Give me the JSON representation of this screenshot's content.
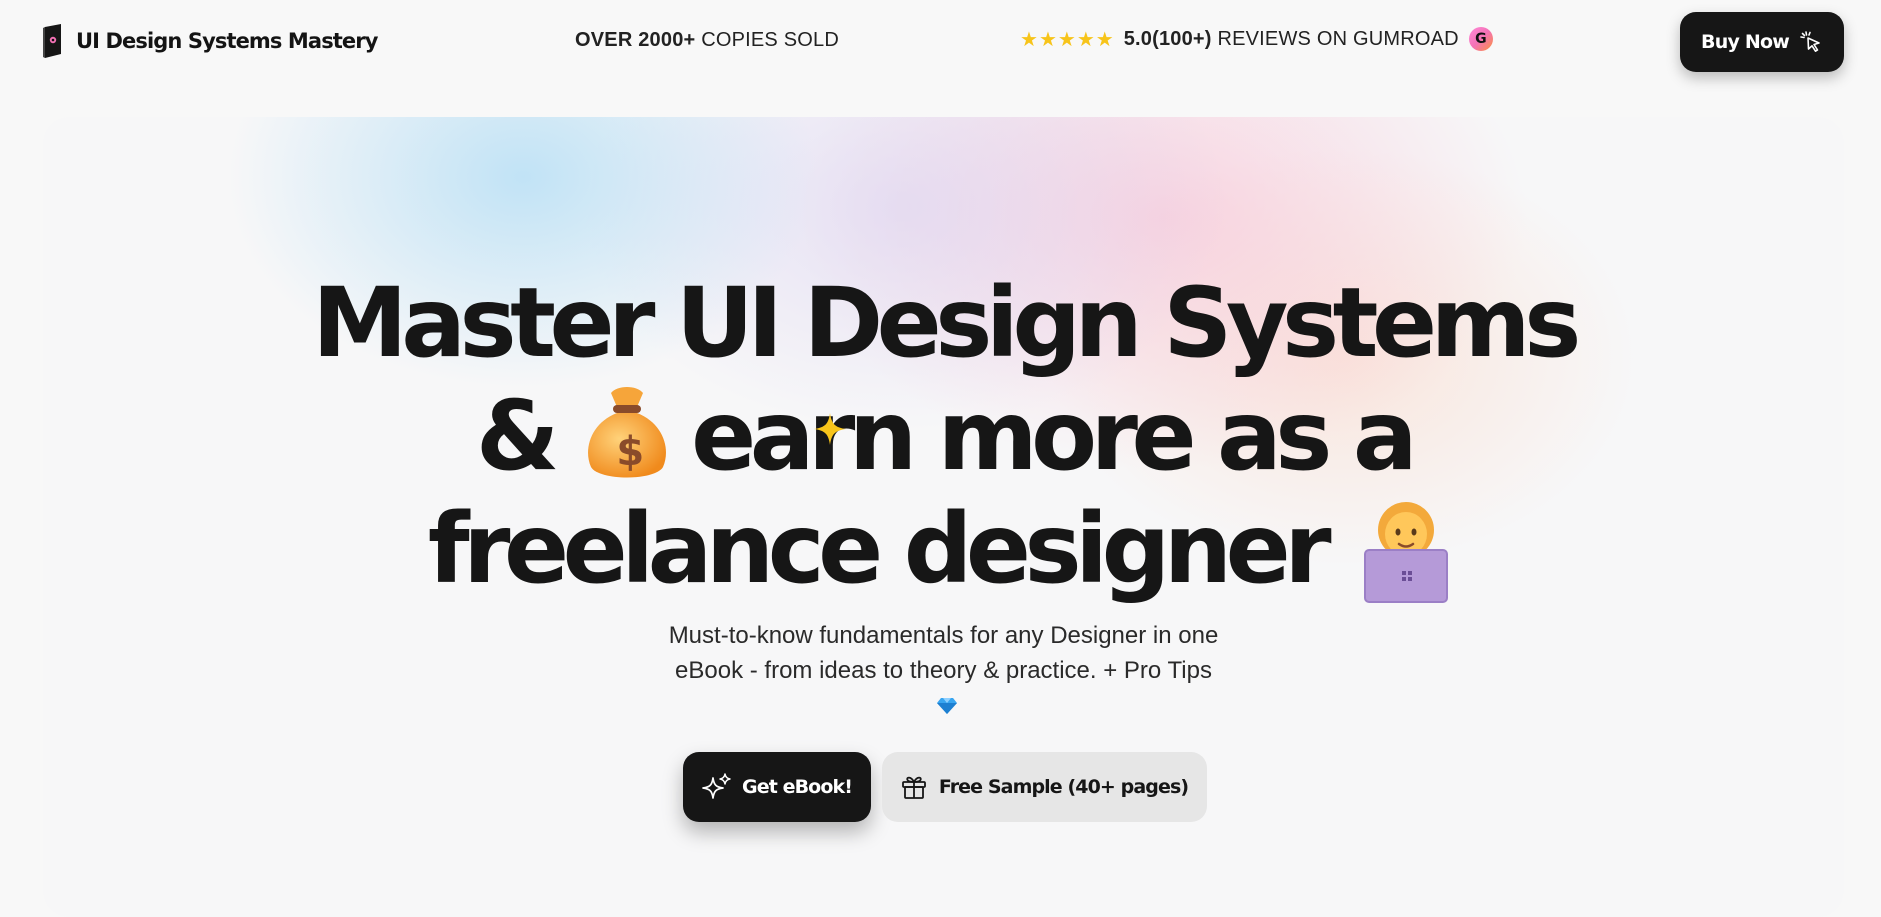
{
  "brand": {
    "name": "UI Design Systems Mastery",
    "logo_icon": "book-icon"
  },
  "stats": {
    "copies_bold": "OVER 2000+",
    "copies_rest": "COPIES SOLD",
    "stars": [
      "★",
      "★",
      "★",
      "★",
      "★"
    ],
    "rating_bold": "5.0(100+)",
    "rating_rest": "REVIEWS ON GUMROAD",
    "gumroad_badge": "G"
  },
  "buy_button": {
    "label": "Buy Now",
    "icon": "pointer-click-icon"
  },
  "hero": {
    "headline": {
      "line1": "Master UI Design Systems",
      "line2_prefix": "&",
      "line2_suffix": "earn more as a",
      "line3": "freelance designer"
    },
    "emojis": [
      "money-bag-emoji",
      "woman-technologist-emoji",
      "sparkle-icon",
      "gem-icon"
    ],
    "subtitle_line1": "Must-to-know fundamentals for any Designer in one",
    "subtitle_line2": "eBook - from ideas to theory & practice. + Pro Tips",
    "primary_cta": {
      "label": "Get eBook!",
      "icon": "sparkles-icon"
    },
    "secondary_cta": {
      "label": "Free Sample (40+ pages)",
      "icon": "gift-icon"
    }
  },
  "colors": {
    "page_bg": "#f8f8f8",
    "dark": "#161616",
    "star": "#f7c41a",
    "secondary_button": "#e6e6e6"
  }
}
